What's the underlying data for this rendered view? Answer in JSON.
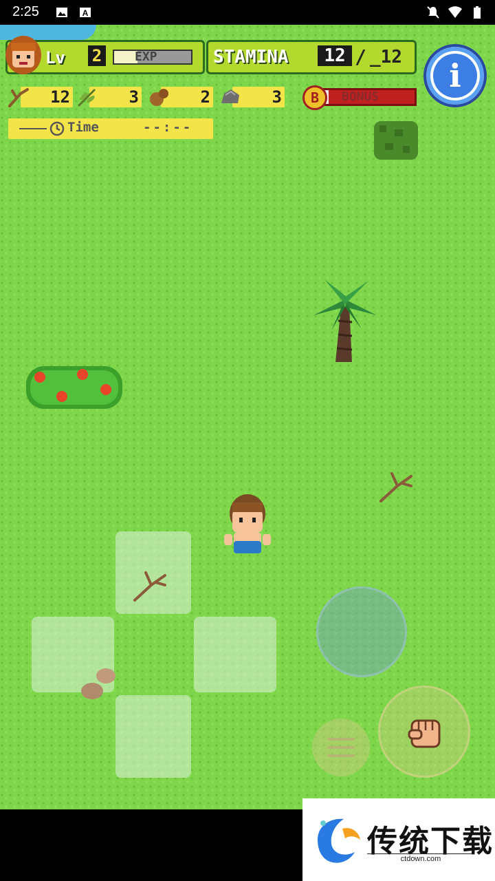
{
  "status_bar": {
    "time": "2:25"
  },
  "hud": {
    "level_label": "Lv",
    "level": "2",
    "exp_label": "EXP",
    "exp_fraction": 0.3,
    "stamina_label": "STAMINA",
    "stamina_current": "12",
    "stamina_slash": "/",
    "stamina_max": "_12",
    "bonus_label": "BONUS",
    "bonus_icon_letter": "B",
    "bonus_fraction": 0.05,
    "time_label": "Time",
    "time_value": "--:--",
    "info_symbol": "i"
  },
  "resources": [
    {
      "name": "branch-icon",
      "count": "12"
    },
    {
      "name": "herb-icon",
      "count": "3"
    },
    {
      "name": "nut-icon",
      "count": "2"
    },
    {
      "name": "stone-icon",
      "count": "3"
    }
  ],
  "ad": {
    "title": "传统下载",
    "subtitle": "ctdown.com"
  },
  "colors": {
    "grass": "#7fd64a",
    "hud_green": "#b3d92e",
    "yellow_box": "#f3e44a",
    "bonus_red": "#c02020",
    "info_blue": "#3c7ee4"
  }
}
